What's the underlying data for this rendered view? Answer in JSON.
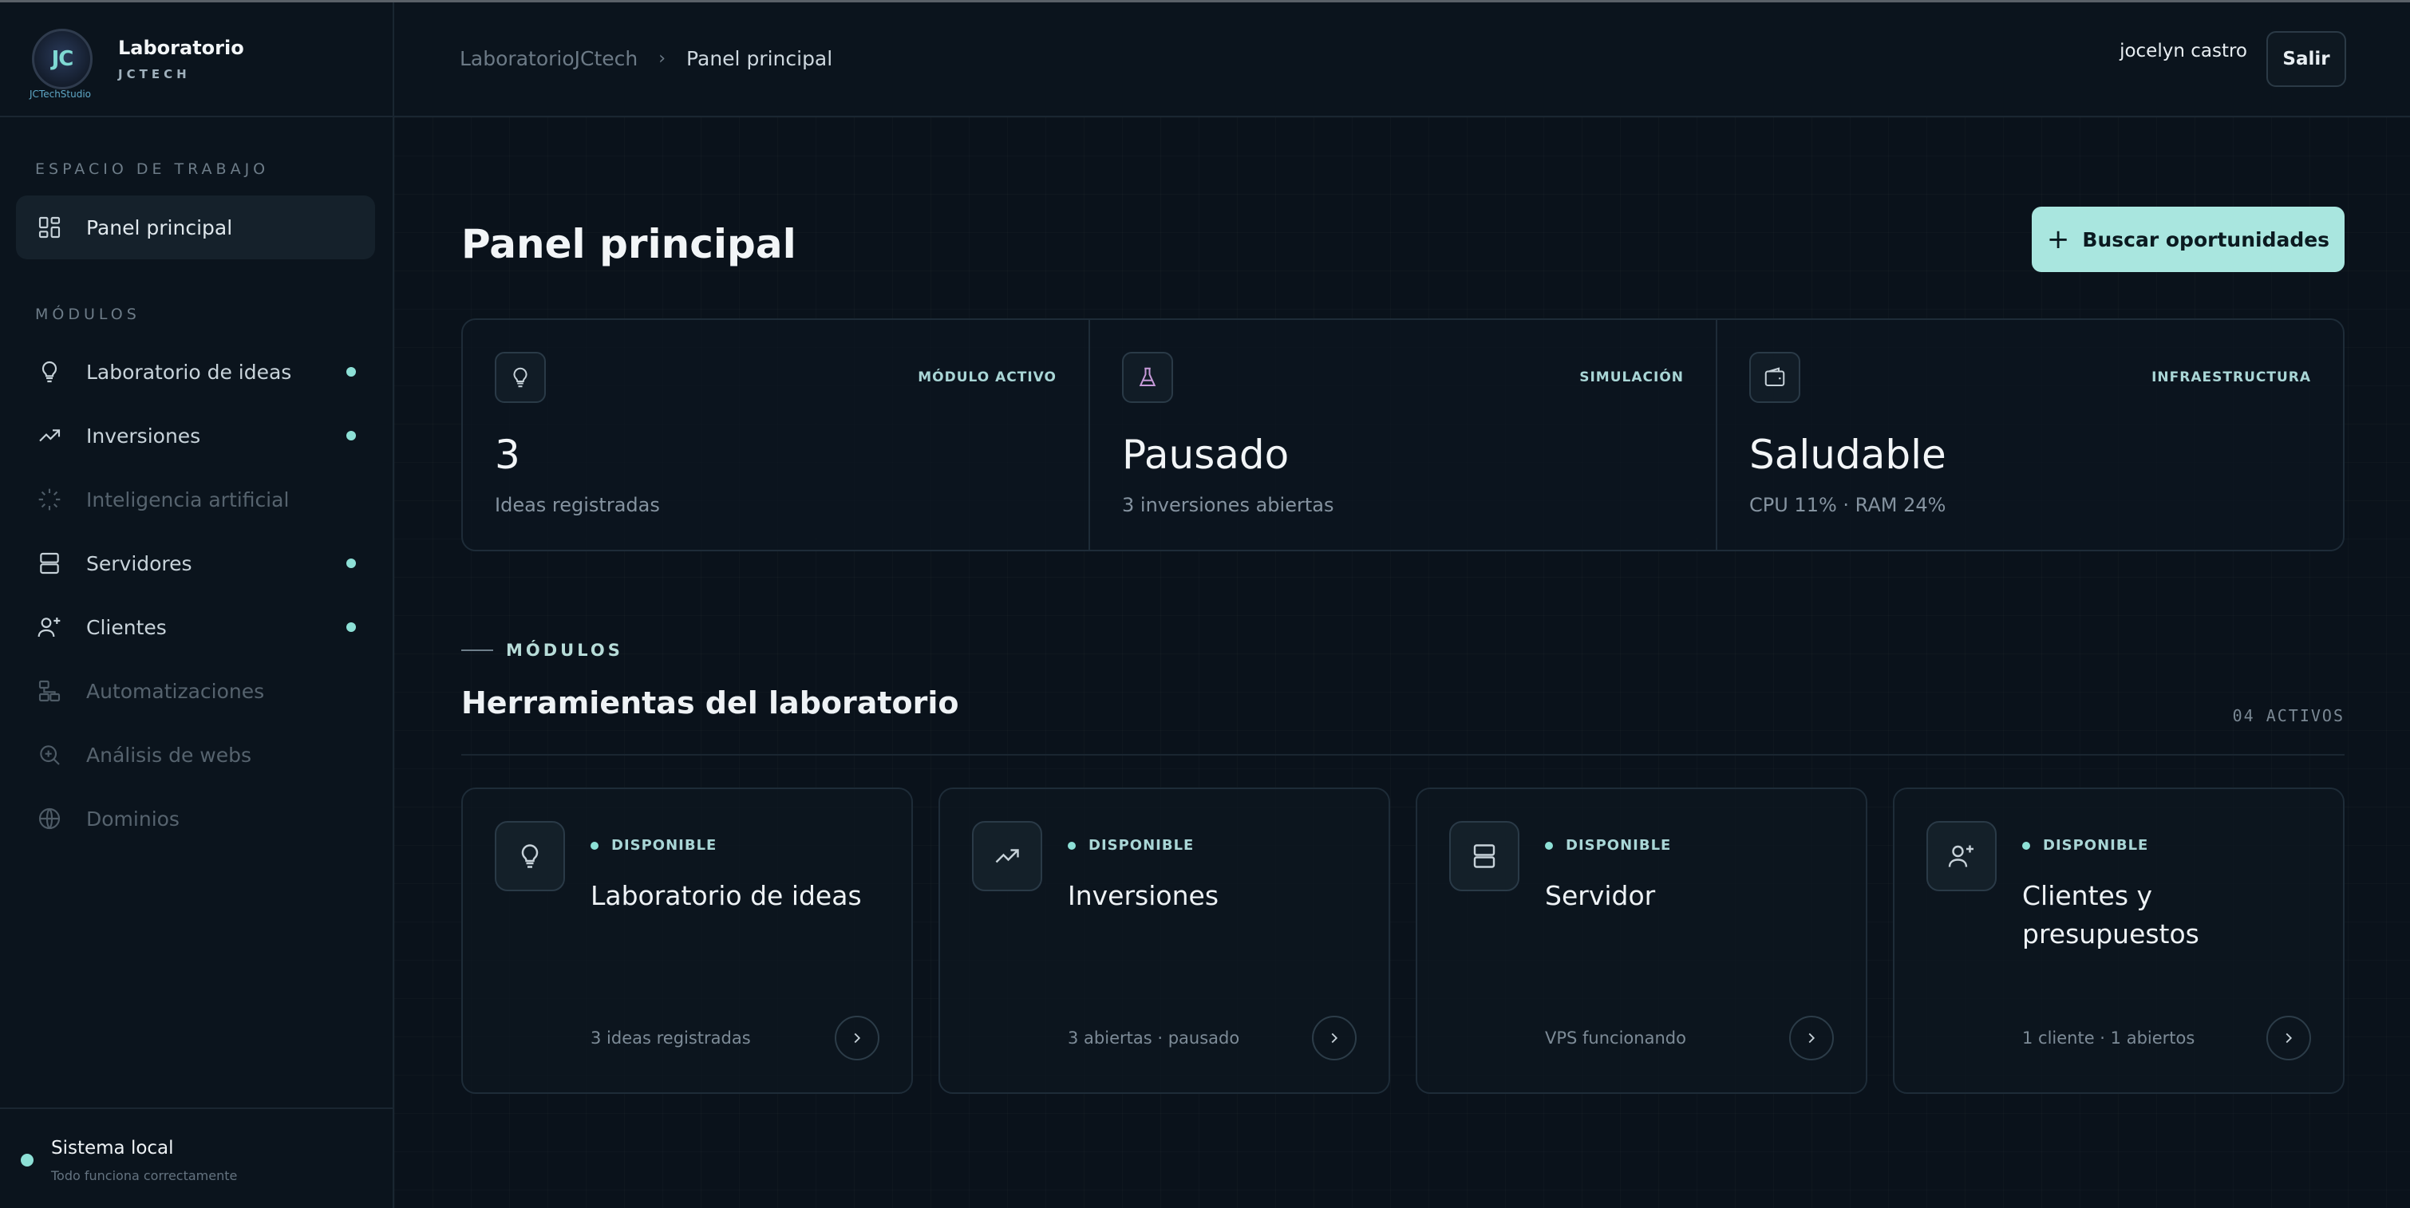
{
  "brand": {
    "name": "Laboratorio",
    "subtitle": "JCTECH",
    "logo_mark": "JC",
    "logo_caption": "JCTechStudio"
  },
  "sidebar": {
    "workspace_label": "ESPACIO DE TRABAJO",
    "workspace_items": [
      {
        "label": "Panel principal",
        "icon": "dashboard-icon",
        "active": true
      }
    ],
    "modules_label": "MÓDULOS",
    "modules": [
      {
        "label": "Laboratorio de ideas",
        "icon": "lightbulb-icon",
        "enabled": true,
        "indicator": true
      },
      {
        "label": "Inversiones",
        "icon": "trending-up-icon",
        "enabled": true,
        "indicator": true
      },
      {
        "label": "Inteligencia artificial",
        "icon": "loader-icon",
        "enabled": false,
        "indicator": false
      },
      {
        "label": "Servidores",
        "icon": "server-icon",
        "enabled": true,
        "indicator": true
      },
      {
        "label": "Clientes",
        "icon": "user-plus-icon",
        "enabled": true,
        "indicator": true
      },
      {
        "label": "Automatizaciones",
        "icon": "workflow-icon",
        "enabled": false,
        "indicator": false
      },
      {
        "label": "Análisis de webs",
        "icon": "zoom-in-icon",
        "enabled": false,
        "indicator": false
      },
      {
        "label": "Dominios",
        "icon": "globe-icon",
        "enabled": false,
        "indicator": false
      }
    ],
    "system": {
      "title": "Sistema local",
      "subtitle": "Todo funciona correctamente"
    }
  },
  "header": {
    "breadcrumb": [
      "LaboratorioJCtech",
      "Panel principal"
    ],
    "breadcrumb_separator": "›",
    "user_name": "jocelyn castro",
    "logout_label": "Salir"
  },
  "main": {
    "title": "Panel principal",
    "cta_label": "Buscar oportunidades",
    "stats": [
      {
        "tag": "MÓDULO ACTIVO",
        "value": "3",
        "desc": "Ideas registradas",
        "icon": "lightbulb-icon"
      },
      {
        "tag": "SIMULACIÓN",
        "value": "Pausado",
        "desc": "3 inversiones abiertas",
        "icon": "flask-icon"
      },
      {
        "tag": "INFRAESTRUCTURA",
        "value": "Saludable",
        "desc": "CPU 11% · RAM 24%",
        "icon": "wallet-icon"
      }
    ],
    "modules_kicker": "MÓDULOS",
    "modules_title": "Herramientas del laboratorio",
    "modules_count": "04 ACTIVOS",
    "cards": [
      {
        "status": "DISPONIBLE",
        "title": "Laboratorio de ideas",
        "footer": "3 ideas registradas",
        "icon": "lightbulb-icon"
      },
      {
        "status": "DISPONIBLE",
        "title": "Inversiones",
        "footer": "3 abiertas · pausado",
        "icon": "trending-up-icon"
      },
      {
        "status": "DISPONIBLE",
        "title": "Servidor",
        "footer": "VPS funcionando",
        "icon": "server-icon"
      },
      {
        "status": "DISPONIBLE",
        "title": "Clientes y presupuestos",
        "footer": "1 cliente · 1 abiertos",
        "icon": "user-plus-icon"
      }
    ]
  },
  "colors": {
    "background": "#0a121b",
    "accent": "#a9e6df",
    "accent_dot": "#8de0d6",
    "flask_icon": "#c79ad9"
  }
}
